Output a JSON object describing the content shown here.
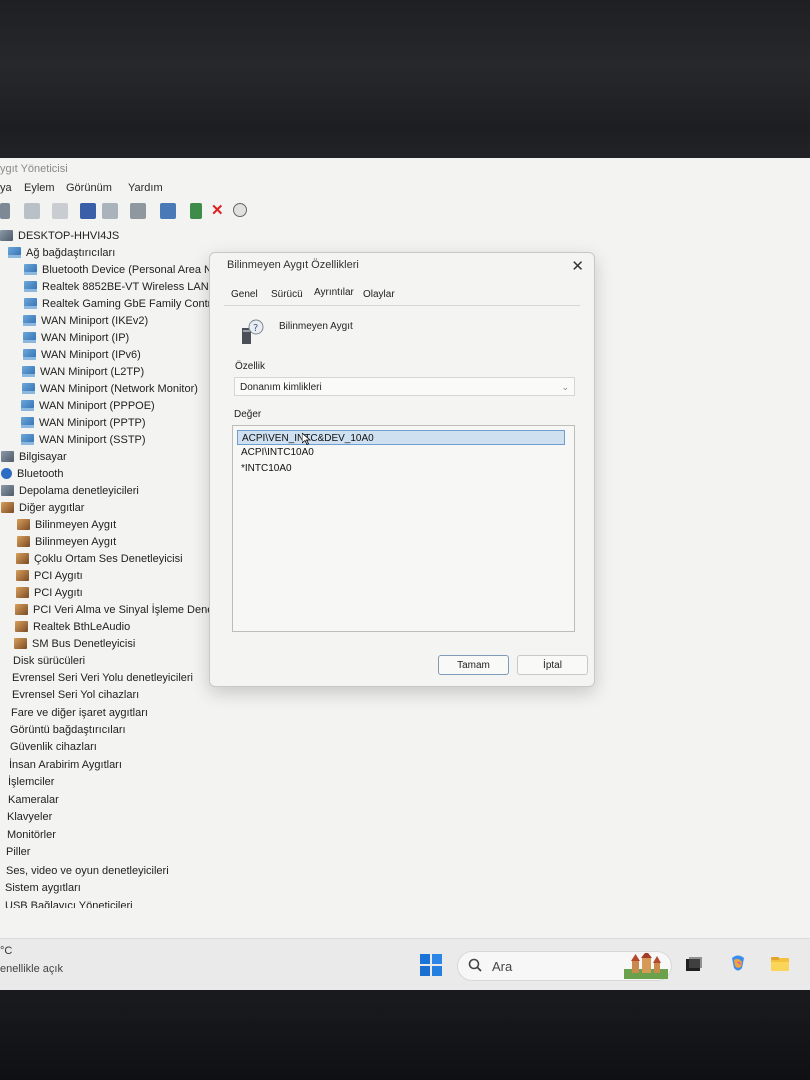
{
  "window": {
    "title": "ygıt Yöneticisi"
  },
  "menu": [
    "ya",
    "Eylem",
    "Görünüm",
    "Yardım"
  ],
  "tree": {
    "root": "DESKTOP-HHVI4JS",
    "network_group": "Ağ bağdaştırıcıları",
    "network_items": [
      "Bluetooth Device (Personal Area Net",
      "Realtek 8852BE-VT Wireless LAN Wi",
      "Realtek Gaming GbE Family Control",
      "WAN Miniport (IKEv2)",
      "WAN Miniport (IP)",
      "WAN Miniport (IPv6)",
      "WAN Miniport (L2TP)",
      "WAN Miniport (Network Monitor)",
      "WAN Miniport (PPPOE)",
      "WAN Miniport (PPTP)",
      "WAN Miniport (SSTP)"
    ],
    "computer": "Bilgisayar",
    "bluetooth": "Bluetooth",
    "storage": "Depolama denetleyicileri",
    "other_group": "Diğer aygıtlar",
    "other_items": [
      "Bilinmeyen Aygıt",
      "Bilinmeyen Aygıt",
      "Çoklu Ortam Ses Denetleyicisi",
      "PCI Aygıtı",
      "PCI Aygıtı",
      "PCI Veri Alma ve Sinyal İşleme Denet",
      "Realtek BthLeAudio",
      "SM Bus Denetleyicisi"
    ],
    "tail": [
      "Disk sürücüleri",
      "Evrensel Seri Veri Yolu denetleyicileri",
      "Evrensel Seri Yol cihazları",
      "Fare ve diğer işaret aygıtları",
      "Görüntü bağdaştırıcıları",
      "Güvenlik cihazları",
      "İnsan Arabirim Aygıtları",
      "İşlemciler",
      "Kameralar",
      "Klavyeler",
      "Monitörler",
      "Piller",
      "Ses, video ve oyun denetleyicileri",
      "Sistem aygıtları",
      "USB Bağlayıcı Yöneticileri"
    ]
  },
  "dialog": {
    "title": "Bilinmeyen Aygıt Özellikleri",
    "tabs": [
      "Genel",
      "Sürücü",
      "Ayrıntılar",
      "Olaylar"
    ],
    "active_tab": "Ayrıntılar",
    "device_name": "Bilinmeyen Aygıt",
    "property_label": "Özellik",
    "property_value": "Donanım kimlikleri",
    "value_label": "Değer",
    "values": [
      "ACPI\\VEN_INTC&DEV_10A0",
      "ACPI\\INTC10A0",
      "*INTC10A0"
    ],
    "ok_label": "Tamam",
    "cancel_label": "İptal"
  },
  "taskbar": {
    "weather_temp": "°C",
    "weather_desc": "enellikle açık",
    "search_placeholder": "Ara"
  }
}
